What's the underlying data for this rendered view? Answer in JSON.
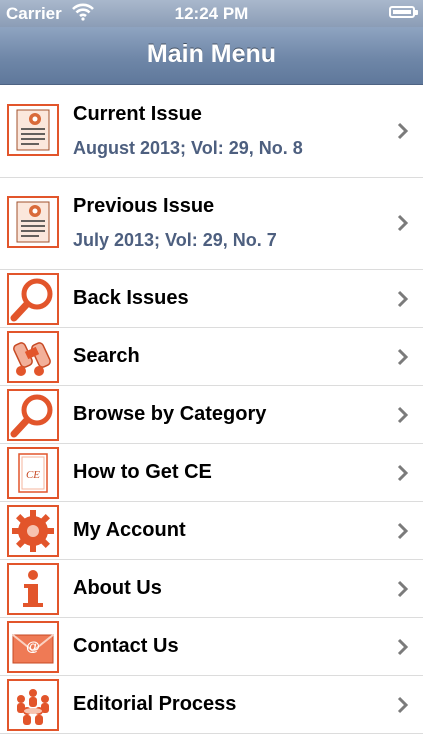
{
  "status_bar": {
    "carrier": "Carrier",
    "time": "12:24 PM"
  },
  "nav": {
    "title": "Main Menu"
  },
  "menu": [
    {
      "label": "Current Issue",
      "sub": "August 2013; Vol: 29, No. 8",
      "icon": "document-icon"
    },
    {
      "label": "Previous Issue",
      "sub": "July 2013; Vol: 29, No. 7",
      "icon": "document-icon"
    },
    {
      "label": "Back Issues",
      "icon": "magnifier-icon"
    },
    {
      "label": "Search",
      "icon": "binoculars-icon"
    },
    {
      "label": "Browse by Category",
      "icon": "magnifier-icon"
    },
    {
      "label": "How to Get CE",
      "icon": "ce-certificate-icon"
    },
    {
      "label": "My Account",
      "icon": "gear-icon"
    },
    {
      "label": "About Us",
      "icon": "info-icon"
    },
    {
      "label": "Contact Us",
      "icon": "envelope-icon"
    },
    {
      "label": "Editorial Process",
      "icon": "people-icon"
    }
  ],
  "colors": {
    "accent": "#e2552b",
    "nav": "#6f87a8",
    "subtext": "#4d5f7f"
  }
}
